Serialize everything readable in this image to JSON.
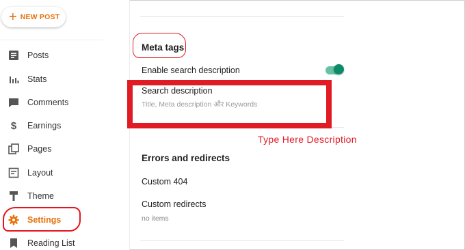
{
  "sidebar": {
    "new_post_label": "NEW POST",
    "items": [
      {
        "label": "Posts",
        "icon": "posts-icon"
      },
      {
        "label": "Stats",
        "icon": "stats-icon"
      },
      {
        "label": "Comments",
        "icon": "comments-icon"
      },
      {
        "label": "Earnings",
        "icon": "earnings-icon"
      },
      {
        "label": "Pages",
        "icon": "pages-icon"
      },
      {
        "label": "Layout",
        "icon": "layout-icon"
      },
      {
        "label": "Theme",
        "icon": "theme-icon"
      },
      {
        "label": "Settings",
        "icon": "gear-icon",
        "active": true
      },
      {
        "label": "Reading List",
        "icon": "bookmark-icon"
      }
    ]
  },
  "main": {
    "meta_tags": {
      "title": "Meta tags",
      "enable_label": "Enable search description",
      "enable_on": true,
      "search_description_label": "Search description",
      "search_description_placeholder": "Title, Meta description और Keywords"
    },
    "annotation": "Type Here Description",
    "errors": {
      "title": "Errors and redirects",
      "custom_404": "Custom 404",
      "custom_redirects": "Custom redirects",
      "no_items": "no items"
    }
  },
  "colors": {
    "accent": "#e8710a",
    "annotation_red": "#e01b24",
    "toggle_track": "#66c2a4",
    "toggle_knob": "#0d8a6a"
  }
}
